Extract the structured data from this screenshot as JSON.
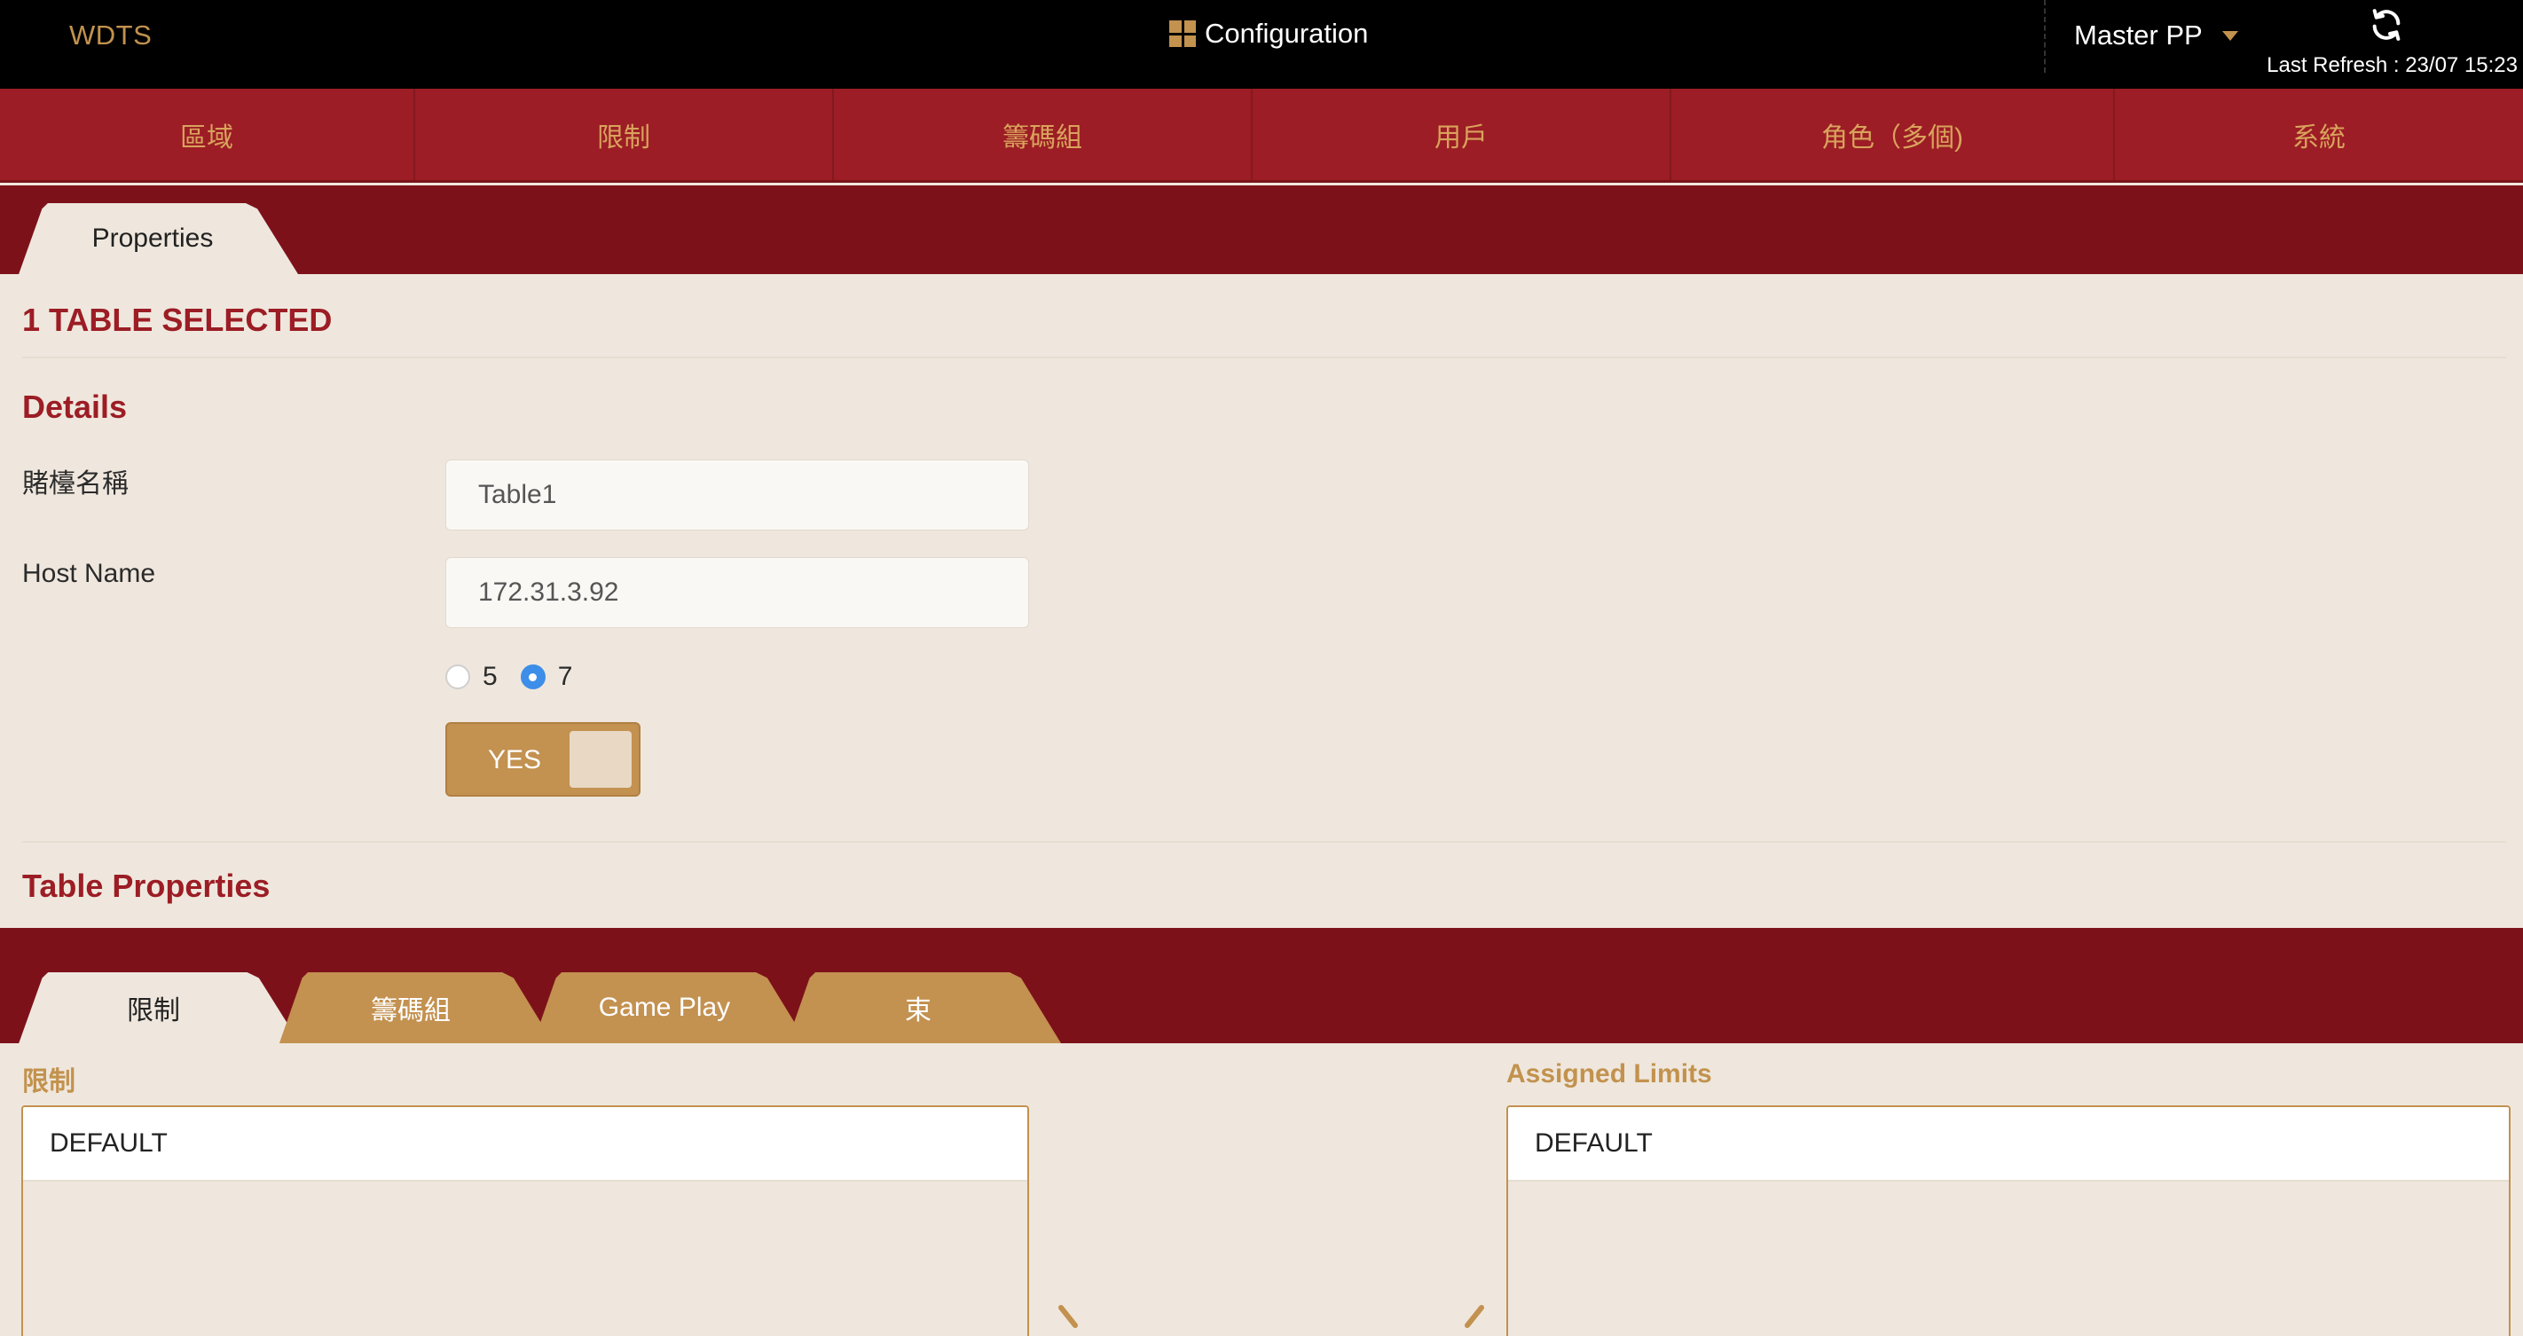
{
  "header": {
    "brand": "WDTS",
    "title": "Configuration",
    "user": "Master PP",
    "last_refresh": "Last Refresh : 23/07 15:23"
  },
  "nav": {
    "items": [
      "區域",
      "限制",
      "籌碼組",
      "用戶",
      "角色（多個)",
      "系統"
    ]
  },
  "tabs": {
    "properties": "Properties"
  },
  "content": {
    "selected": "1 TABLE SELECTED",
    "details_title": "Details",
    "table_name_label": "賭檯名稱",
    "table_name_value": "Table1",
    "host_name_label": "Host Name",
    "host_name_value": "172.31.3.92",
    "radio_options": [
      "5",
      "7"
    ],
    "radio_selected": "7",
    "toggle_label": "YES",
    "table_properties_title": "Table Properties"
  },
  "bottom_tabs": [
    "限制",
    "籌碼組",
    "Game Play",
    "束"
  ],
  "limits": {
    "left_label": "限制",
    "left_items": [
      "DEFAULT"
    ],
    "right_label": "Assigned Limits",
    "right_items": [
      "DEFAULT"
    ]
  },
  "colors": {
    "top_bar": "#000000",
    "nav_red": "#9c1d25",
    "strip_red": "#7d111a",
    "gold": "#c39150",
    "background": "#efe7dd",
    "radio_selected": "#3d8ee8"
  }
}
